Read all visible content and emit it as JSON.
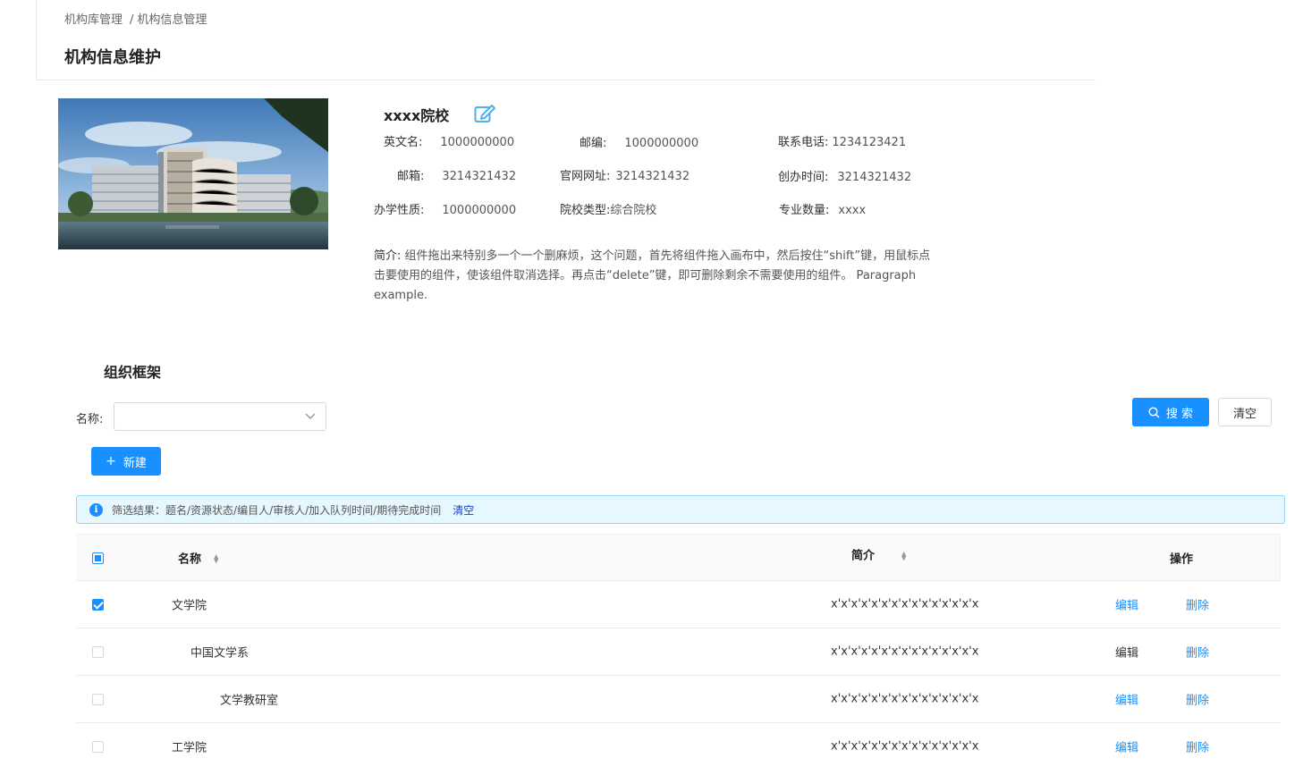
{
  "breadcrumb": {
    "items": [
      "机构库管理",
      "机构信息管理"
    ],
    "separator": "/"
  },
  "page_title": "机构信息维护",
  "school": {
    "name": "xxxx院校",
    "fields": {
      "english_name": {
        "label": "英文名:",
        "value": "1000000000"
      },
      "postcode": {
        "label": "邮编:",
        "value": "1000000000"
      },
      "phone": {
        "label": "联系电话:",
        "value": "1234123421"
      },
      "email": {
        "label": "邮箱:",
        "value": "3214321432"
      },
      "website": {
        "label": "官网网址:",
        "value": "3214321432"
      },
      "founded": {
        "label": "创办时间:",
        "value": "3214321432"
      },
      "nature": {
        "label": "办学性质:",
        "value": "1000000000"
      },
      "type": {
        "label": "院校类型:",
        "value": "综合院校"
      },
      "majors": {
        "label": "专业数量:",
        "value": "xxxx"
      }
    },
    "intro_label": "简介:",
    "intro_line1": "组件拖出来特别多一个一个删麻烦，这个问题，首先将组件拖入画布中，然后按住“shift”键，用鼠标点",
    "intro_line2": "击要使用的组件，使该组件取消选择。再点击“delete”键，即可删除剩余不需要使用的组件。 Paragraph",
    "intro_line3": "example."
  },
  "org": {
    "title": "组织框架",
    "filter_label": "名称:",
    "filter_value": "",
    "search_label": "搜 索",
    "clear_label": "清空",
    "new_label": "新建",
    "alert_text": "筛选结果：题名/资源状态/编目人/审核人/加入队列时间/期待完成时间",
    "alert_clear": "清空",
    "columns": {
      "name": "名称",
      "intro": "简介",
      "action": "操作"
    },
    "edit_label": "编辑",
    "delete_label": "删除",
    "rows": [
      {
        "name": "文学院",
        "intro": "x'x'x'x'x'x'x'x'x'x'x'x'x'x'x",
        "checked": true,
        "level": 0,
        "edit_highlight": true
      },
      {
        "name": "中国文学系",
        "intro": "x'x'x'x'x'x'x'x'x'x'x'x'x'x'x",
        "checked": false,
        "level": 1,
        "edit_highlight": false
      },
      {
        "name": "文学教研室",
        "intro": "x'x'x'x'x'x'x'x'x'x'x'x'x'x'x",
        "checked": false,
        "level": 2,
        "edit_highlight": true
      },
      {
        "name": "工学院",
        "intro": "x'x'x'x'x'x'x'x'x'x'x'x'x'x'x",
        "checked": false,
        "level": 0,
        "edit_highlight": true
      }
    ]
  },
  "colors": {
    "primary": "#1890ff",
    "alert_bg": "#e6f7ff",
    "alert_border": "#91d5ff",
    "link_dark": "#1a3fd0"
  }
}
